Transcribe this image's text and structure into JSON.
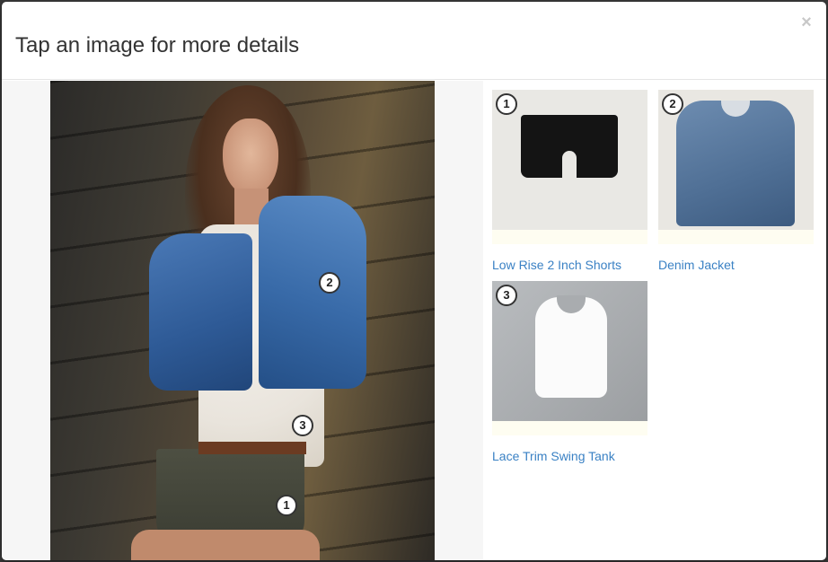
{
  "modal": {
    "title": "Tap an image for more details",
    "close_label": "×"
  },
  "hotspots": [
    {
      "number": "2"
    },
    {
      "number": "3"
    },
    {
      "number": "1"
    }
  ],
  "products": [
    {
      "number": "1",
      "name": "Low Rise 2 Inch Shorts"
    },
    {
      "number": "2",
      "name": "Denim Jacket"
    },
    {
      "number": "3",
      "name": "Lace Trim Swing Tank"
    }
  ],
  "colors": {
    "link": "#3a81c4",
    "title": "#333333",
    "backdrop": "#3a3a3a"
  }
}
